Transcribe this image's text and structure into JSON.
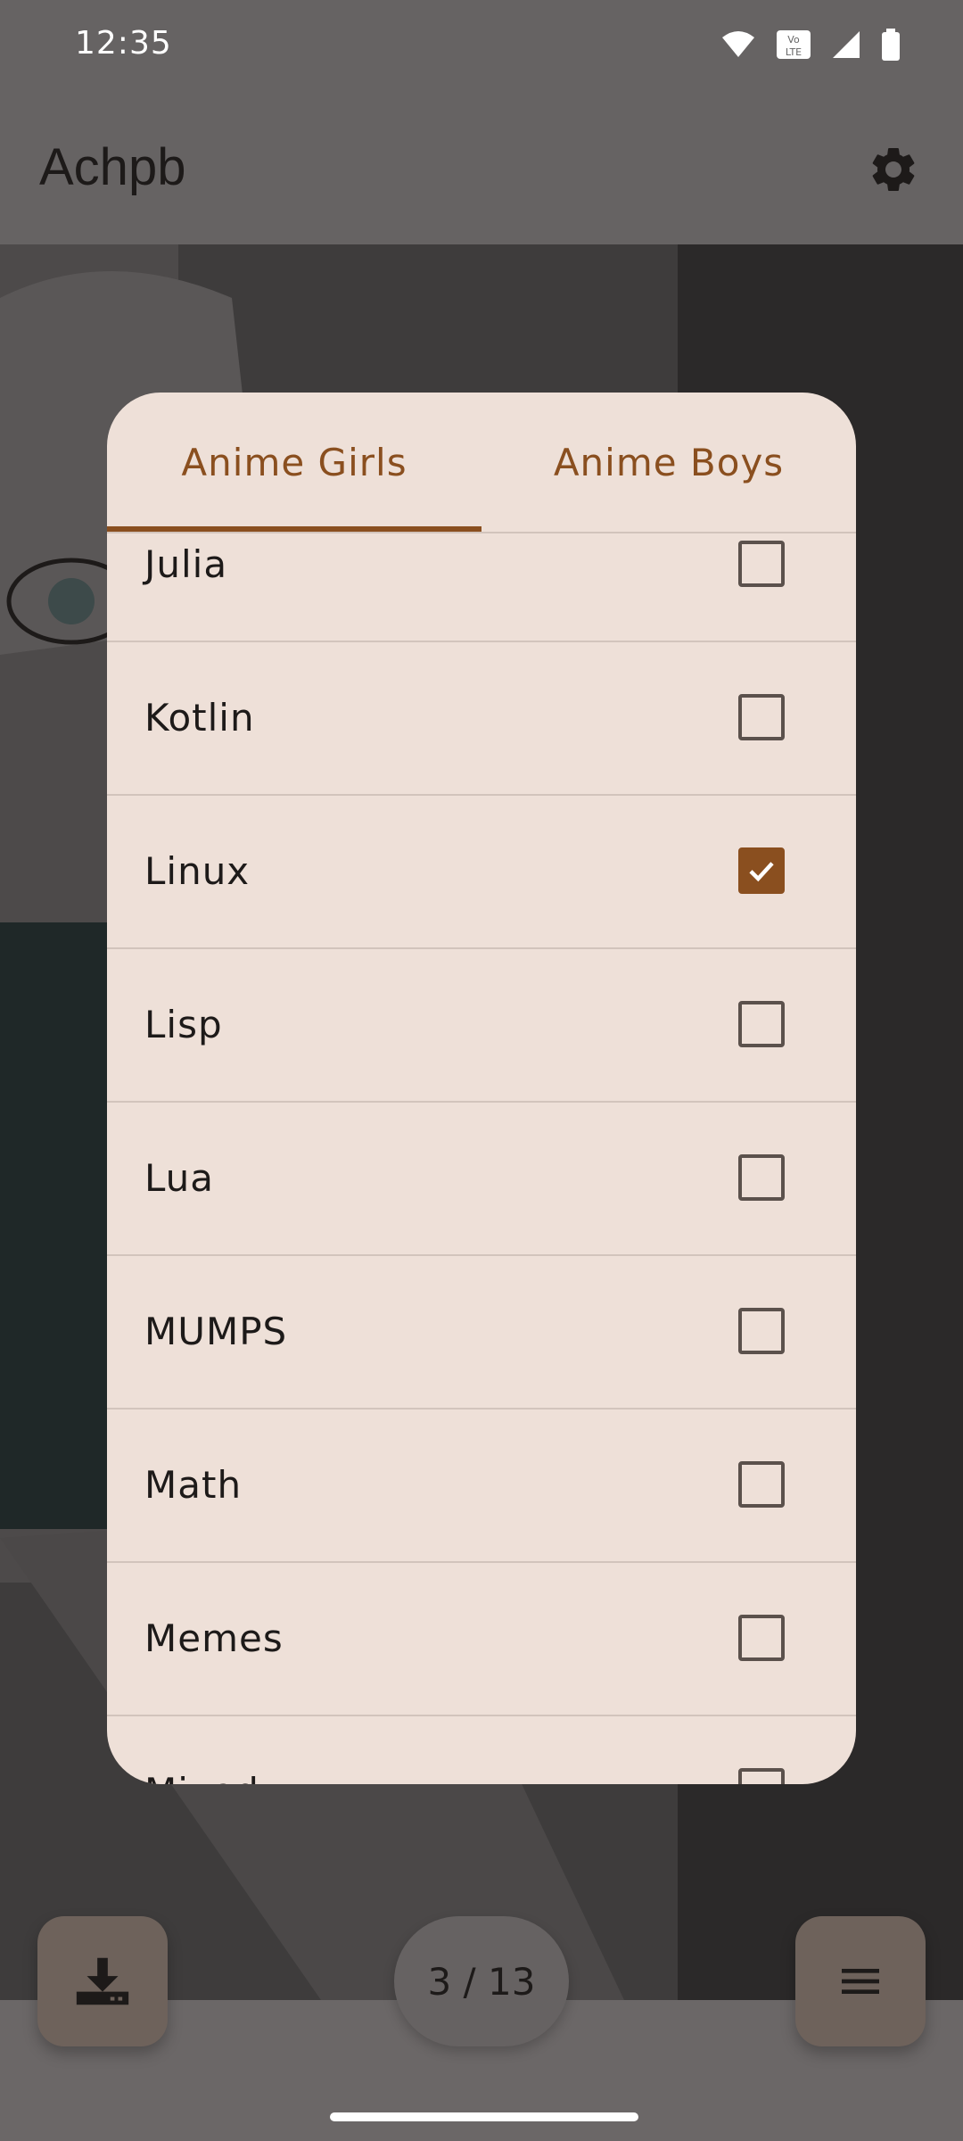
{
  "status_bar": {
    "time": "12:35"
  },
  "app_bar": {
    "title": "Achpb"
  },
  "dialog": {
    "tabs": [
      {
        "label": "Anime Girls",
        "selected": true
      },
      {
        "label": "Anime Boys",
        "selected": false
      }
    ],
    "items": [
      {
        "label": "Julia",
        "checked": false
      },
      {
        "label": "Kotlin",
        "checked": false
      },
      {
        "label": "Linux",
        "checked": true
      },
      {
        "label": "Lisp",
        "checked": false
      },
      {
        "label": "Lua",
        "checked": false
      },
      {
        "label": "MUMPS",
        "checked": false
      },
      {
        "label": "Math",
        "checked": false
      },
      {
        "label": "Memes",
        "checked": false
      },
      {
        "label": "Mixed",
        "checked": false
      }
    ]
  },
  "pager": {
    "counter": "3 / 13"
  },
  "colors": {
    "accent": "#8a4f1f",
    "dialog_bg": "#eee0d8",
    "scrim": "#666363"
  },
  "icons": {
    "settings": "gear-icon",
    "download": "download-icon",
    "menu": "menu-icon"
  }
}
